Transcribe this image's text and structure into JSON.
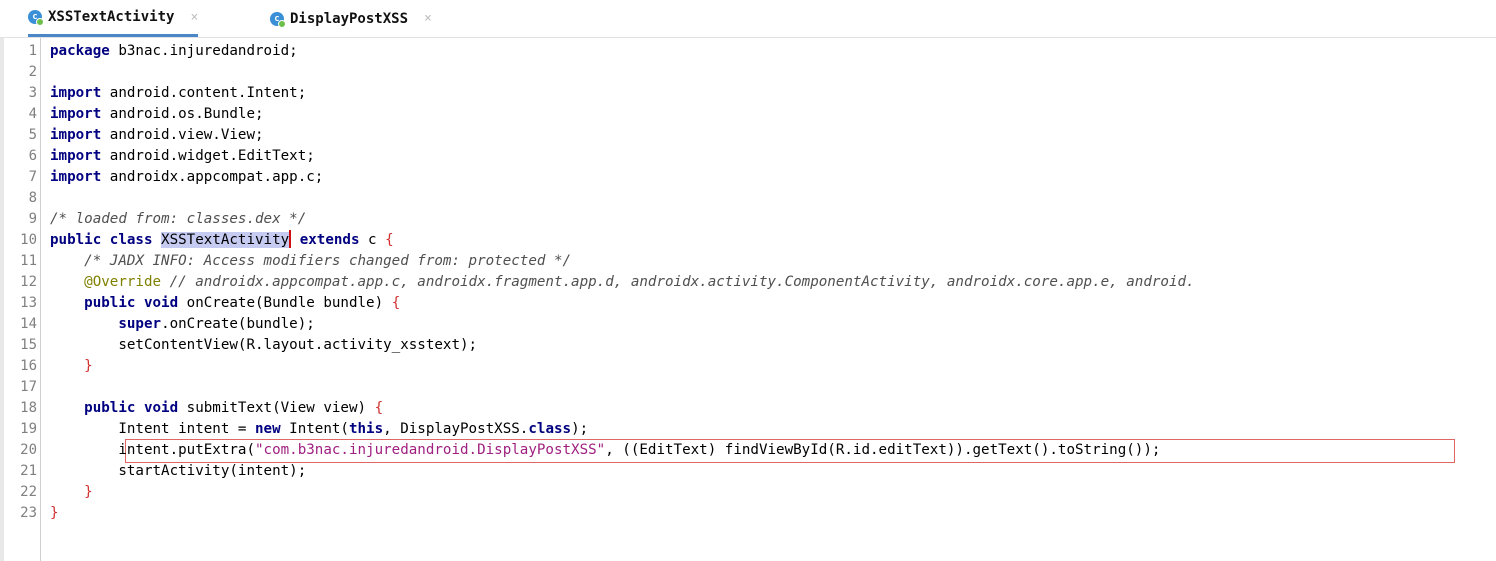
{
  "tabs": [
    {
      "label": "XSSTextActivity",
      "icon": "class-icon",
      "active": true
    },
    {
      "label": "DisplayPostXSS",
      "icon": "class-icon",
      "active": false
    }
  ],
  "close_glyph": "×",
  "class_icon_letter": "c",
  "editor": {
    "lines": [
      [
        {
          "t": "kw",
          "v": "package"
        },
        {
          "t": "p",
          "v": " b3nac.injuredandroid;"
        }
      ],
      [],
      [
        {
          "t": "kw",
          "v": "import"
        },
        {
          "t": "p",
          "v": " android.content.Intent;"
        }
      ],
      [
        {
          "t": "kw",
          "v": "import"
        },
        {
          "t": "p",
          "v": " android.os.Bundle;"
        }
      ],
      [
        {
          "t": "kw",
          "v": "import"
        },
        {
          "t": "p",
          "v": " android.view.View;"
        }
      ],
      [
        {
          "t": "kw",
          "v": "import"
        },
        {
          "t": "p",
          "v": " android.widget.EditText;"
        }
      ],
      [
        {
          "t": "kw",
          "v": "import"
        },
        {
          "t": "p",
          "v": " androidx.appcompat.app.c;"
        }
      ],
      [],
      [
        {
          "t": "cm",
          "v": "/* loaded from: classes.dex */"
        }
      ],
      [
        {
          "t": "kw",
          "v": "public class"
        },
        {
          "t": "p",
          "v": " "
        },
        {
          "t": "sel",
          "v": "XSSTextActivity"
        },
        {
          "t": "caret",
          "v": ""
        },
        {
          "t": "p",
          "v": " "
        },
        {
          "t": "kw",
          "v": "extends"
        },
        {
          "t": "p",
          "v": " c "
        },
        {
          "t": "br",
          "v": "{"
        }
      ],
      [
        {
          "t": "p",
          "v": "    "
        },
        {
          "t": "cm",
          "v": "/* JADX INFO: Access modifiers changed from: protected */"
        }
      ],
      [
        {
          "t": "p",
          "v": "    "
        },
        {
          "t": "an",
          "v": "@Override"
        },
        {
          "t": "p",
          "v": " "
        },
        {
          "t": "cm",
          "v": "// androidx.appcompat.app.c, androidx.fragment.app.d, androidx.activity.ComponentActivity, androidx.core.app.e, android."
        }
      ],
      [
        {
          "t": "p",
          "v": "    "
        },
        {
          "t": "kw",
          "v": "public void"
        },
        {
          "t": "p",
          "v": " onCreate(Bundle bundle) "
        },
        {
          "t": "br",
          "v": "{"
        }
      ],
      [
        {
          "t": "p",
          "v": "        "
        },
        {
          "t": "kw",
          "v": "super"
        },
        {
          "t": "p",
          "v": ".onCreate(bundle);"
        }
      ],
      [
        {
          "t": "p",
          "v": "        setContentView(R.layout.activity_xsstext);"
        }
      ],
      [
        {
          "t": "p",
          "v": "    "
        },
        {
          "t": "br",
          "v": "}"
        }
      ],
      [],
      [
        {
          "t": "p",
          "v": "    "
        },
        {
          "t": "kw",
          "v": "public void"
        },
        {
          "t": "p",
          "v": " submitText(View view) "
        },
        {
          "t": "br",
          "v": "{"
        }
      ],
      [
        {
          "t": "p",
          "v": "        Intent intent = "
        },
        {
          "t": "kw",
          "v": "new"
        },
        {
          "t": "p",
          "v": " Intent("
        },
        {
          "t": "kw",
          "v": "this"
        },
        {
          "t": "p",
          "v": ", DisplayPostXSS."
        },
        {
          "t": "kw",
          "v": "class"
        },
        {
          "t": "p",
          "v": ");"
        }
      ],
      [
        {
          "t": "p",
          "v": "        intent.putExtra("
        },
        {
          "t": "st",
          "v": "\"com.b3nac.injuredandroid.DisplayPostXSS\""
        },
        {
          "t": "p",
          "v": ", ((EditText) findViewById(R.id.editText)).getText().toString());"
        }
      ],
      [
        {
          "t": "p",
          "v": "        startActivity(intent);"
        }
      ],
      [
        {
          "t": "p",
          "v": "    "
        },
        {
          "t": "br",
          "v": "}"
        }
      ],
      [
        {
          "t": "br",
          "v": "}"
        }
      ]
    ]
  }
}
